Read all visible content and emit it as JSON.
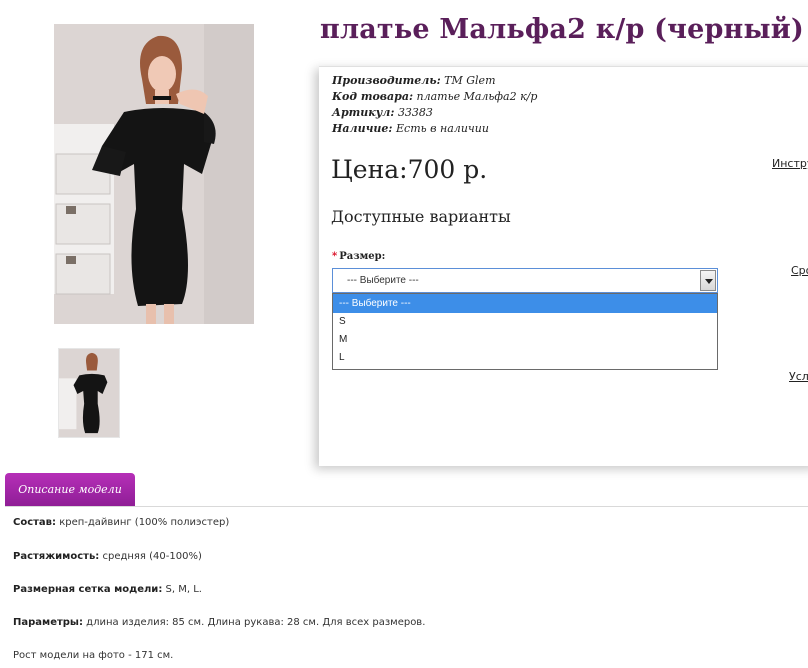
{
  "product": {
    "title": "платье Мальфа2 к/р (черный)",
    "meta": [
      {
        "key": "Производитель:",
        "value": "TM Glem"
      },
      {
        "key": "Код товара:",
        "value": "платье Мальфа2 к/р"
      },
      {
        "key": "Артикул:",
        "value": "33383"
      },
      {
        "key": "Наличие:",
        "value": "Есть в наличии"
      }
    ],
    "price": "Цена:700 р.",
    "variants_title": "Доступные варианты"
  },
  "size_select": {
    "required_mark": "*",
    "label": "Размер:",
    "value": "--- Выберите ---",
    "options": [
      "--- Выберите ---",
      "S",
      "M",
      "L"
    ]
  },
  "side_links": [
    "Инстру",
    "Сро",
    "Усл"
  ],
  "tabs": {
    "description": "Описание модели"
  },
  "description": [
    {
      "key": "Состав:",
      "value": "креп-дайвинг (100% полиэстер)"
    },
    {
      "key": "Растяжимость:",
      "value": "средняя (40-100%)"
    },
    {
      "key": "Размерная сетка модели:",
      "value": "S, M, L."
    },
    {
      "key": "Параметры:",
      "value": "длина изделия: 85 см. Длина рукава: 28 см. Для всех размеров."
    },
    {
      "key": "",
      "value": "Рост модели на фото - 171 см."
    }
  ],
  "colors": {
    "title": "#5a1f5a",
    "tab_bg": "#a527a9",
    "select_highlight": "#3d8ee8",
    "required": "#d8001a"
  }
}
